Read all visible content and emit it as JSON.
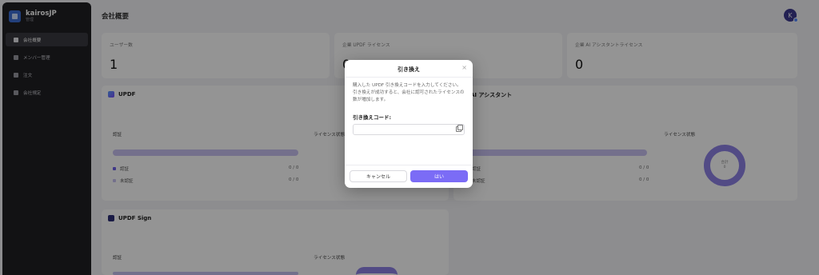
{
  "sidebar": {
    "brand_name": "kairosJP",
    "brand_sub": "管理",
    "items": [
      {
        "label": "会社概要",
        "icon": "building-icon",
        "active": true
      },
      {
        "label": "メンバー管理",
        "icon": "members-icon",
        "active": false
      },
      {
        "label": "注文",
        "icon": "order-icon",
        "active": false
      },
      {
        "label": "会社規定",
        "icon": "settings-icon",
        "active": false
      }
    ]
  },
  "header": {
    "title": "会社概要",
    "avatar_initial": "K"
  },
  "stats": [
    {
      "label": "ユーザー数",
      "value": "1"
    },
    {
      "label": "企業 UPDF ライセンス",
      "value": "0"
    },
    {
      "label": "企業 AI アシスタントライセンス",
      "value": "0"
    }
  ],
  "updf": {
    "title": "UPDF",
    "auth_label": "認証",
    "license_label": "ライセンス状態",
    "legend": [
      {
        "label": "認証",
        "value": "0 / 0",
        "color": "#6d5fe8"
      },
      {
        "label": "未認証",
        "value": "0 / 0",
        "color": "#c9c2f2"
      }
    ]
  },
  "ai": {
    "title": "AI アシスタント",
    "license_label": "ライセンス状態",
    "legend": [
      {
        "label": "認証",
        "value": "0 / 0"
      },
      {
        "label": "未認証",
        "value": "0 / 0"
      }
    ],
    "donut_line1": "合計",
    "donut_line2": "0"
  },
  "sign": {
    "title": "UPDF Sign",
    "auth_label": "認証",
    "license_label": "ライセンス状態"
  },
  "modal": {
    "title": "引き換え",
    "description": "購入した UPDF 引き換えコードを入力してください。引き換えが成功すると、会社に認可されたライセンスの数が増加します。",
    "code_label": "引き換えコード:",
    "code_value": "",
    "cancel_label": "キャンセル",
    "ok_label": "はい"
  },
  "colors": {
    "accent": "#7b6cf6",
    "sidebar_bg": "#1f1f23"
  }
}
